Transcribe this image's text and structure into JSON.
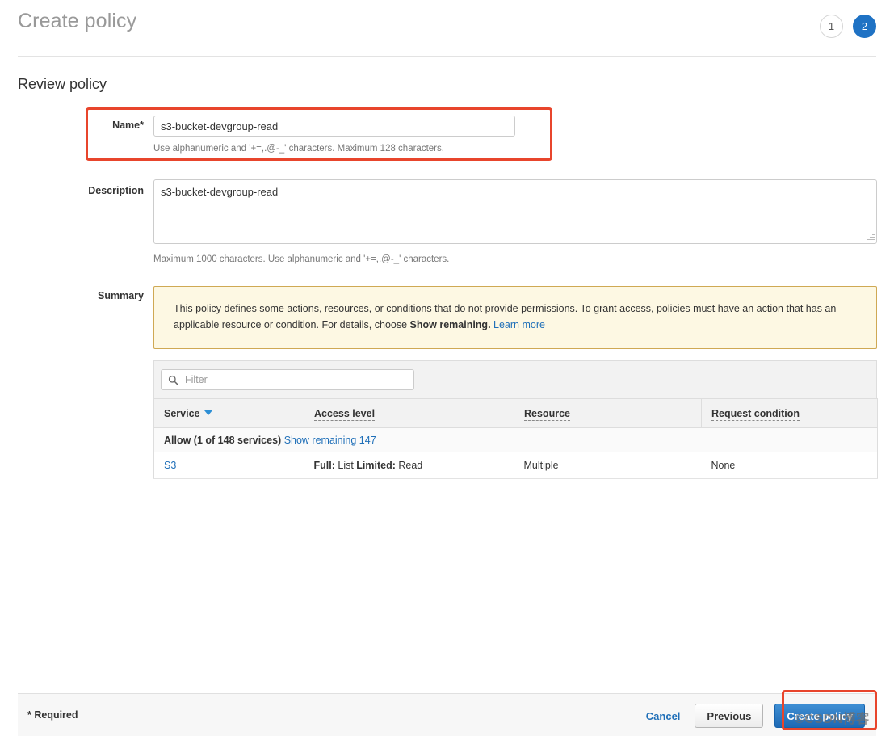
{
  "header": {
    "wizard_title": "Create policy",
    "steps": [
      {
        "number": "1",
        "state": "inactive"
      },
      {
        "number": "2",
        "state": "active"
      }
    ]
  },
  "section": {
    "heading": "Review policy"
  },
  "form": {
    "name": {
      "label": "Name*",
      "value": "s3-bucket-devgroup-read",
      "placeholder": "",
      "help": "Use alphanumeric and '+=,.@-_' characters. Maximum 128 characters."
    },
    "description": {
      "label": "Description",
      "value": "s3-bucket-devgroup-read",
      "placeholder": "",
      "help": "Maximum 1000 characters. Use alphanumeric and '+=,.@-_' characters."
    },
    "summary": {
      "label": "Summary",
      "warning_part1": "This policy defines some actions, resources, or conditions that do not provide permissions. To grant access, policies must have an action that has an applicable resource or condition. For details, choose ",
      "warning_bold": "Show remaining.",
      "warning_link": "Learn more"
    }
  },
  "table": {
    "filter_placeholder": "Filter",
    "filter_value": "",
    "search_icon": "search-icon",
    "columns": [
      {
        "label": "Service",
        "sorted": true,
        "dotted": false
      },
      {
        "label": "Access level",
        "sorted": false,
        "dotted": true
      },
      {
        "label": "Resource",
        "sorted": false,
        "dotted": true
      },
      {
        "label": "Request condition",
        "sorted": false,
        "dotted": true
      }
    ],
    "group_row": {
      "text": "Allow (1 of 148 services)",
      "link": "Show remaining 147"
    },
    "rows": [
      {
        "service": "S3",
        "access_full_label": "Full:",
        "access_full_value": " List ",
        "access_limited_label": "Limited:",
        "access_limited_value": " Read",
        "resource": "Multiple",
        "request_condition": "None"
      }
    ]
  },
  "footer": {
    "required_note": "* Required",
    "cancel_label": "Cancel",
    "previous_label": "Previous",
    "create_label": "Create policy"
  },
  "watermark": {
    "text": "©CSDN博客"
  },
  "colors": {
    "accent_blue": "#1f72c4",
    "link_blue": "#1f6fb8",
    "annotation_red": "#e8452c",
    "warning_bg": "#fdf8e3",
    "warning_border": "#cfa954"
  }
}
